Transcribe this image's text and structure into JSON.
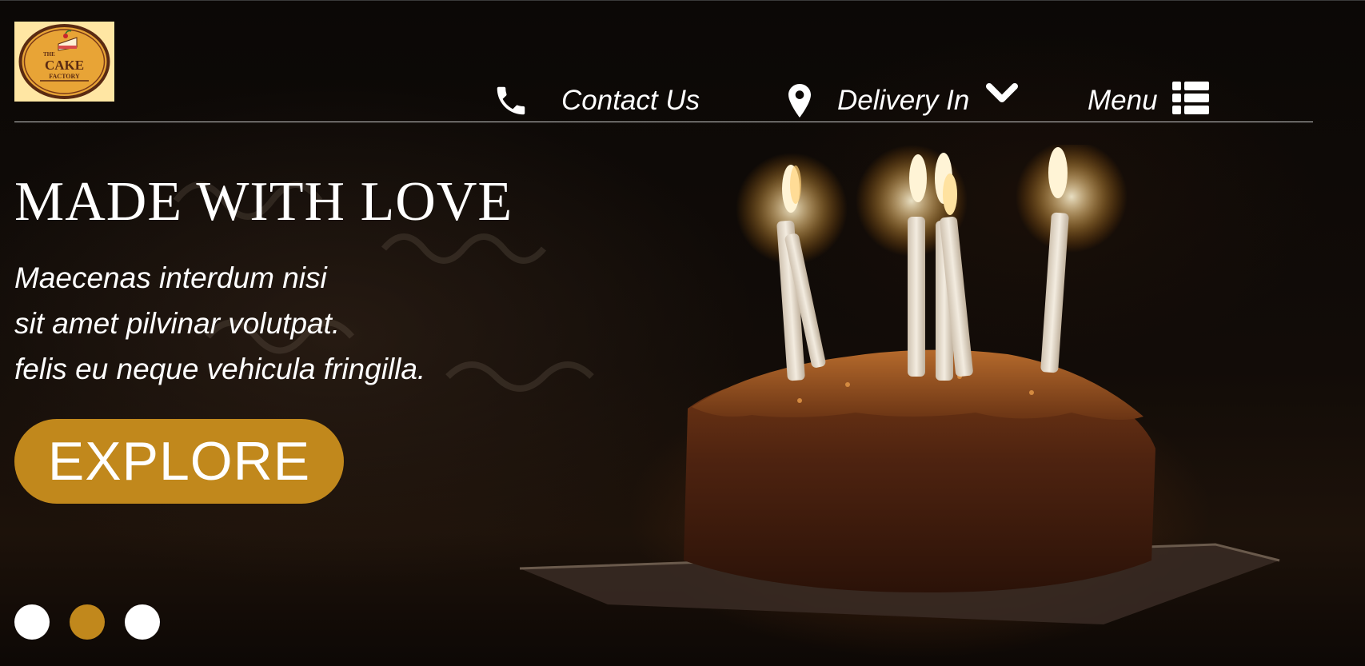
{
  "brand": {
    "logo_line1": "THE",
    "logo_line2": "CAKE",
    "logo_line3": "FACTORY"
  },
  "nav": {
    "contact_label": "Contact Us",
    "delivery_label": "Delivery In",
    "menu_label": "Menu",
    "icons": [
      "phone-icon",
      "location-pin-icon",
      "chevron-down-icon",
      "list-icon"
    ]
  },
  "hero": {
    "headline": "MADE WITH LOVE",
    "lines": [
      "Maecenas interdum nisi",
      "sit amet pilvinar volutpat.",
      "felis eu neque vehicula fringilla."
    ],
    "cta_label": "EXPLORE"
  },
  "carousel": {
    "slide_count": 3,
    "active_index": 1
  },
  "colors": {
    "accent": "#c1881c",
    "text": "#ffffff",
    "logo_bg": "#ffe6a3"
  }
}
